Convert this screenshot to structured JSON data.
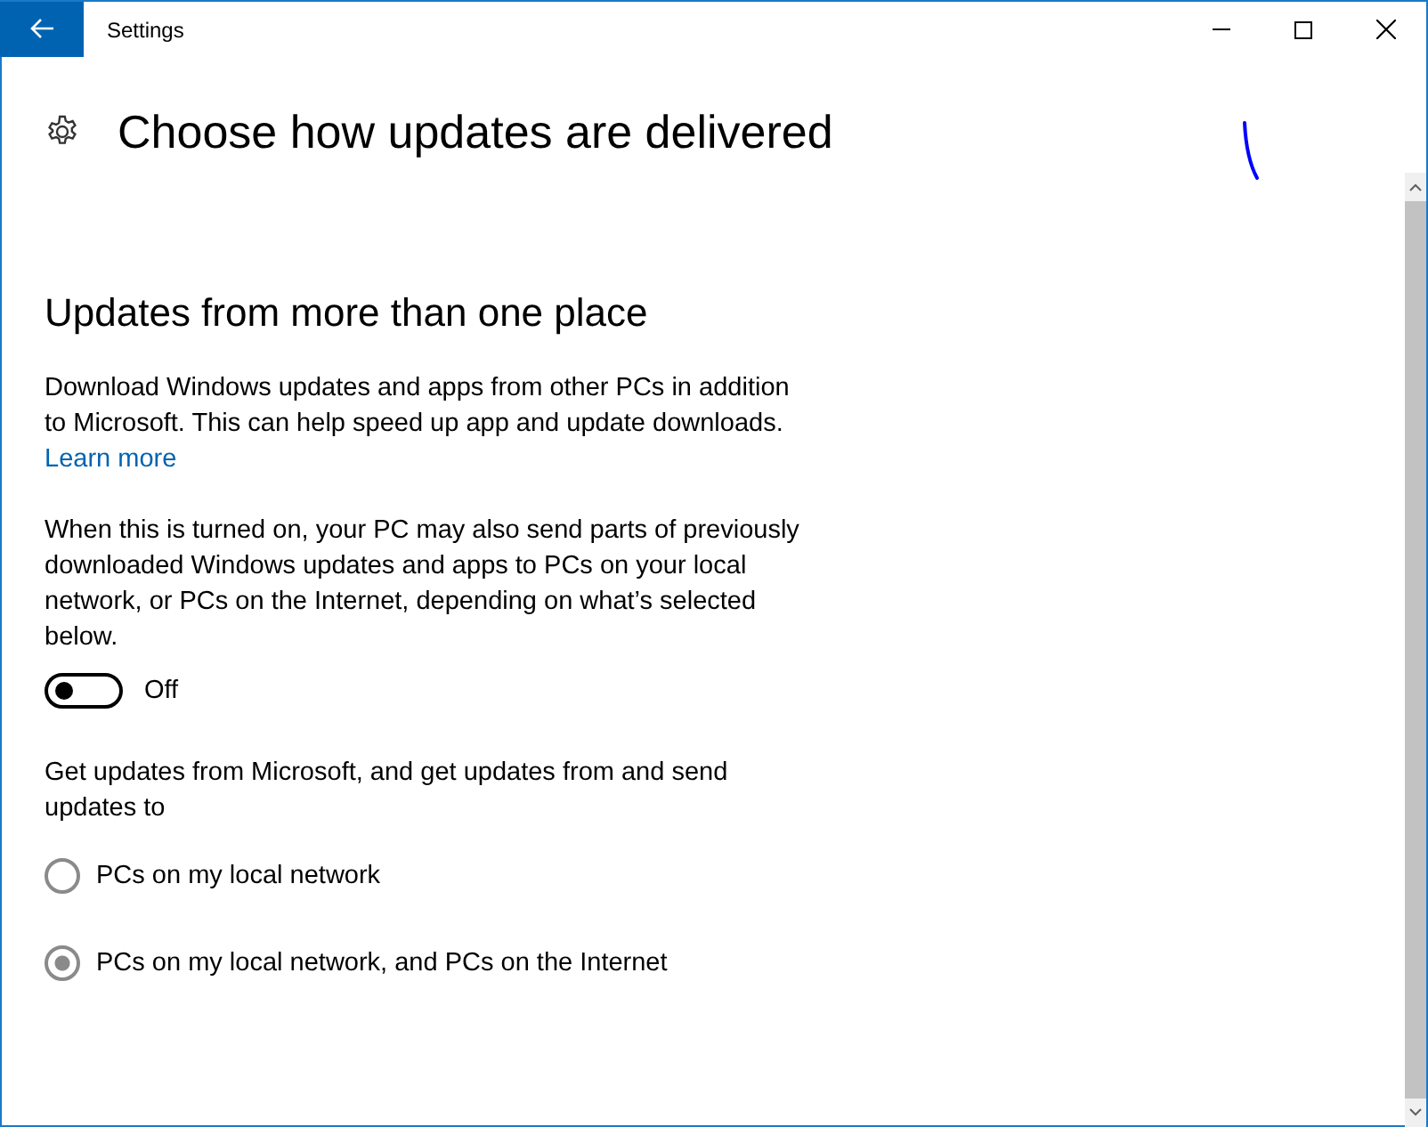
{
  "window": {
    "title": "Settings"
  },
  "page": {
    "title": "Choose how updates are delivered"
  },
  "section": {
    "heading": "Updates from more than one place",
    "description": "Download Windows updates and apps from other PCs in addition to Microsoft. This can help speed up app and update downloads.",
    "link": "Learn more",
    "note": "When this is turned on, your PC may also send parts of previously downloaded Windows updates and apps to PCs on your local network, or PCs on the Internet, depending on what’s selected below.",
    "toggle": {
      "on": false,
      "label": "Off"
    },
    "prompt": "Get updates from Microsoft, and get updates from and send updates to",
    "options": [
      {
        "label": "PCs on my local network",
        "selected": false
      },
      {
        "label": "PCs on my local network, and PCs on the Internet",
        "selected": true
      }
    ]
  }
}
